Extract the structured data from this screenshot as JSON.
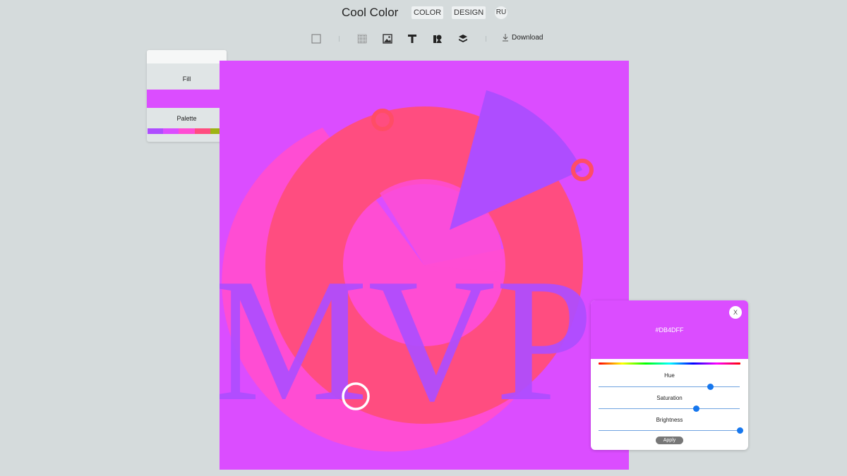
{
  "header": {
    "title": "Cool Color",
    "nav": [
      "COLOR",
      "DESIGN"
    ],
    "lang": "RU"
  },
  "toolbar": {
    "tools": [
      "frame-icon",
      "texture-icon",
      "image-icon",
      "text-icon",
      "shape-icon",
      "layers-icon"
    ],
    "download_label": "Download"
  },
  "fill_panel": {
    "fill_label": "Fill",
    "fill_color": "#DB4DFF",
    "palette_label": "Palette",
    "palette": [
      "#AE4DFF",
      "#DB4DFF",
      "#FF4DD3",
      "#FF4D80",
      "#9EB314"
    ]
  },
  "canvas": {
    "text": "MVP",
    "background": "#DB4DFF"
  },
  "picker": {
    "hex": "#DB4DFF",
    "close_label": "X",
    "sliders": [
      {
        "label": "Hue",
        "value": 0.79
      },
      {
        "label": "Saturation",
        "value": 0.69
      },
      {
        "label": "Brightness",
        "value": 1.0
      }
    ],
    "apply_label": "Apply"
  }
}
